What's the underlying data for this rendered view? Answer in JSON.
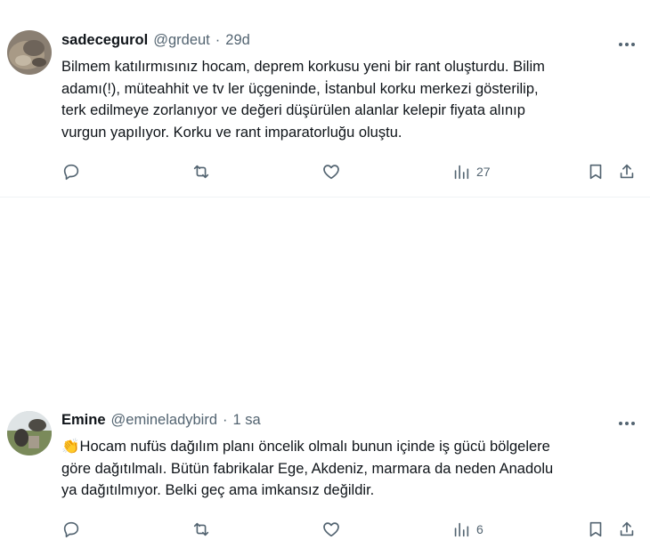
{
  "tweets": [
    {
      "name": "sadecegurol",
      "handle": "@grdeut",
      "separator": "·",
      "time": "29d",
      "lines": [
        "Bilmem katılırmısınız hocam, deprem korkusu yeni bir rant oluşturdu. Bilim",
        "adamı(!), müteahhit ve tv ler üçgeninde, İstanbul korku merkezi gösterilip,",
        "terk edilmeye zorlanıyor ve değeri düşürülen alanlar kelepir fiyata alınıp",
        "vurgun yapılıyor. Korku ve rant  imparatorluğu oluştu."
      ],
      "views": "27"
    },
    {
      "name": "Emine",
      "handle": "@emineladybird",
      "separator": "·",
      "time": "1 sa",
      "lines": [
        "👏Hocam nufüs dağılım planı öncelik olmalı bunun içinde iş gücü bölgelere",
        "göre dağıtılmalı. Bütün fabrikalar Ege, Akdeniz, marmara da  neden Anadolu",
        "ya dağıtılmıyor. Belki geç ama imkansız değildir."
      ],
      "views": "6"
    }
  ],
  "icons": {
    "reply": "reply-icon",
    "retweet": "retweet-icon",
    "like": "heart-icon",
    "views": "views-chart-icon",
    "bookmark": "bookmark-icon",
    "share": "share-icon",
    "more": "more-dots-icon"
  },
  "colors": {
    "text": "#0f1419",
    "secondary": "#536471",
    "divider": "#eff3f4"
  }
}
